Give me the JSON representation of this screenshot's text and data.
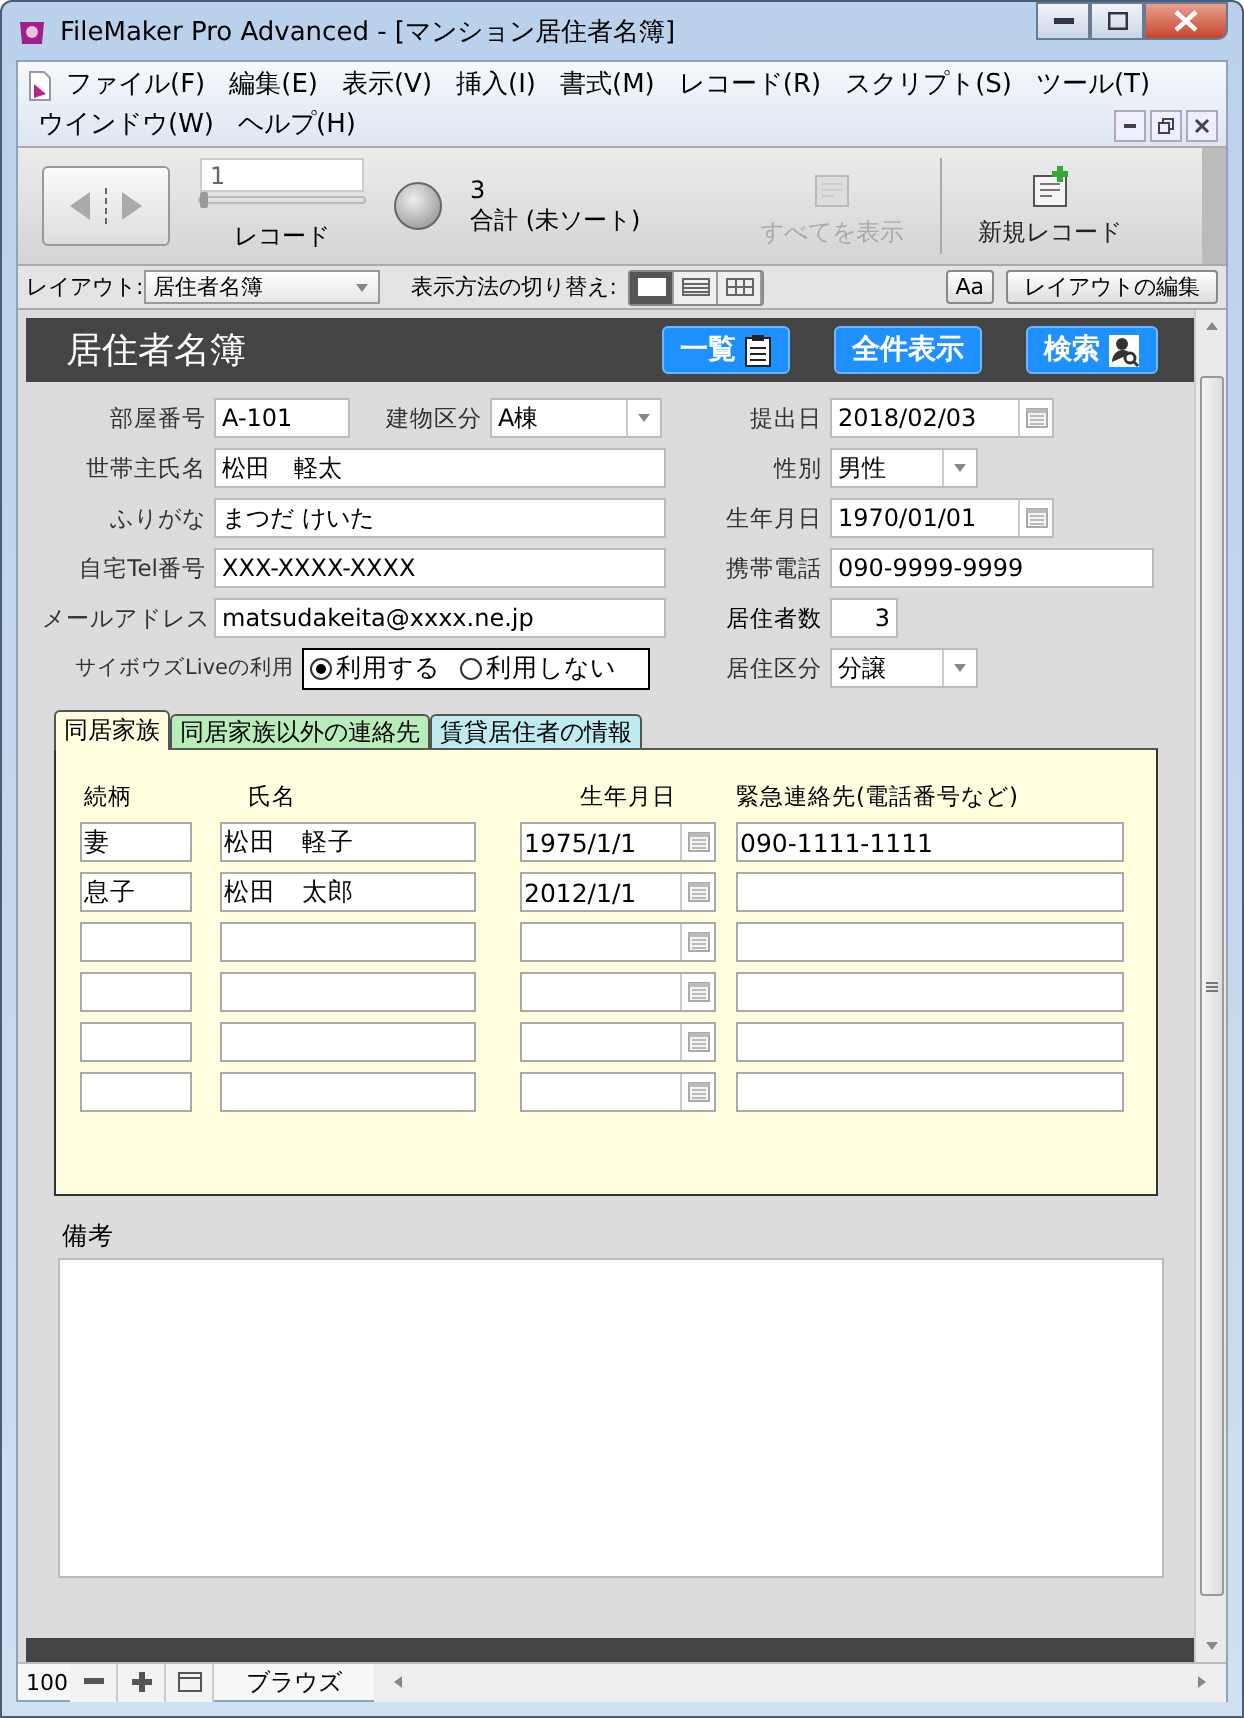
{
  "window": {
    "title": "FileMaker Pro Advanced - [マンション居住者名簿]"
  },
  "menu": [
    {
      "label": "ファイル(F)"
    },
    {
      "label": "編集(E)"
    },
    {
      "label": "表示(V)"
    },
    {
      "label": "挿入(I)"
    },
    {
      "label": "書式(M)"
    },
    {
      "label": "レコード(R)"
    },
    {
      "label": "スクリプト(S)"
    },
    {
      "label": "ツール(T)"
    },
    {
      "label": "ウインドウ(W)"
    },
    {
      "label": "ヘルプ(H)"
    }
  ],
  "toolbar": {
    "record_number": "1",
    "record_label": "レコード",
    "record_slider": {
      "level": 0
    },
    "found_count": "3",
    "total_label": "合計 (未ソート)",
    "actions": [
      {
        "label": "すべてを表示",
        "disabled": true
      },
      {
        "label": "新規レコード",
        "disabled": false
      }
    ]
  },
  "layout_bar": {
    "layout_label": "レイアウト:",
    "layout": "居住者名簿",
    "view_label": "表示方法の切り替え:",
    "views": [
      {
        "selected": true
      },
      {
        "selected": false
      },
      {
        "selected": false
      }
    ],
    "text_button": "Aa",
    "edit_button": "レイアウトの編集"
  },
  "form": {
    "title": "居住者名簿",
    "buttons": [
      {
        "label": "一覧",
        "kind": "list"
      },
      {
        "label": "全件表示",
        "kind": "plain"
      },
      {
        "label": "検索",
        "kind": "search"
      }
    ],
    "left_fields": [
      {
        "label": "部屋番号",
        "value": "A-101",
        "kind": "short",
        "extra": {
          "label": "建物区分",
          "value": "A棟"
        }
      },
      {
        "label": "世帯主氏名",
        "value": "松田　軽太",
        "kind": "text"
      },
      {
        "label": "ふりがな",
        "value": "まつだ けいた",
        "kind": "text"
      },
      {
        "label": "自宅Tel番号",
        "value": "XXX-XXXX-XXXX",
        "kind": "text"
      },
      {
        "label": "メールアドレス",
        "value": "matsudakeita@xxxx.ne.jp",
        "kind": "text"
      },
      {
        "label": "サイボウズLiveの利用",
        "kind": "radio",
        "options": [
          {
            "label": "利用する",
            "selected": true
          },
          {
            "label": "利用しない",
            "selected": false
          }
        ]
      }
    ],
    "right_fields": [
      {
        "label": "提出日",
        "value": "2018/02/03",
        "kind": "date"
      },
      {
        "label": "性別",
        "value": "男性",
        "kind": "dropdown"
      },
      {
        "label": "生年月日",
        "value": "1970/01/01",
        "kind": "date"
      },
      {
        "label": "携帯電話",
        "value": "090-9999-9999",
        "kind": "text"
      },
      {
        "label": "居住者数",
        "value": "3",
        "kind": "number"
      },
      {
        "label": "居住区分",
        "value": "分譲",
        "kind": "dropdown"
      }
    ],
    "tabs": [
      {
        "label": "同居家族",
        "selected": true,
        "color": "#ffffe0"
      },
      {
        "label": "同居家族以外の連絡先",
        "selected": false,
        "color": "#b8ecb8"
      },
      {
        "label": "賃貸居住者の情報",
        "selected": false,
        "color": "#bfeaf0"
      }
    ],
    "family_table": {
      "columns": [
        "続柄",
        "氏名",
        "生年月日",
        "緊急連絡先(電話番号など)"
      ],
      "rows": [
        {
          "relation": "妻",
          "name": "松田　軽子",
          "birth": "1975/1/1",
          "contact": "090-1111-1111"
        },
        {
          "relation": "息子",
          "name": "松田　太郎",
          "birth": "2012/1/1"
        },
        {},
        {},
        {},
        {}
      ]
    },
    "notes_label": "備考"
  },
  "status_bar": {
    "zoom": "100",
    "mode": "ブラウズ"
  }
}
